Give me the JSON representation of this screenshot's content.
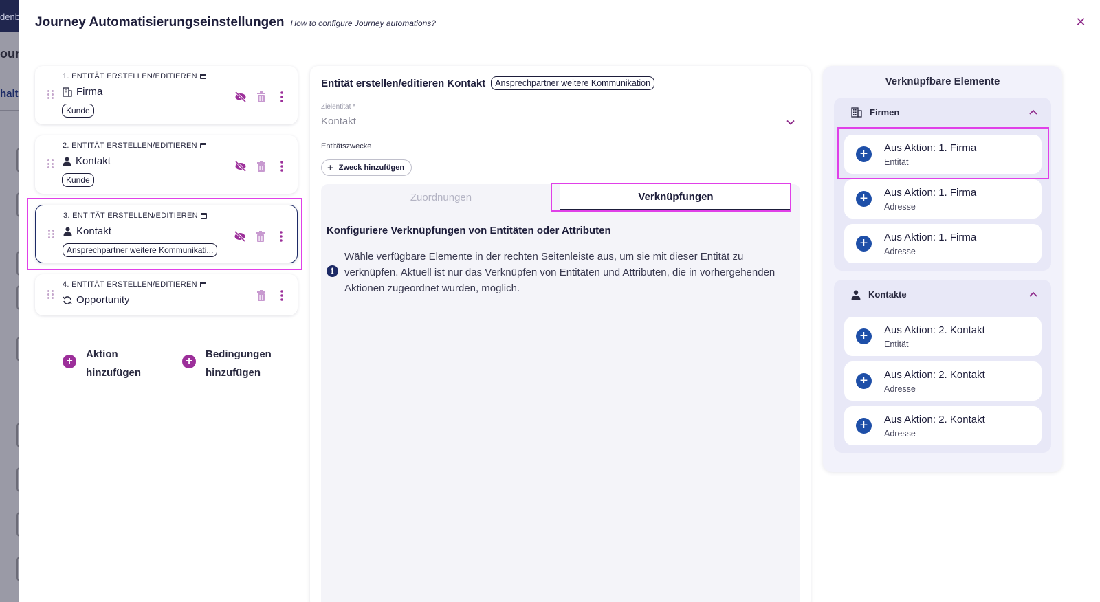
{
  "backdrop": {
    "top_text": "denb",
    "title_text": "our",
    "tab_text": "halt"
  },
  "header": {
    "title": "Journey Automatisierungseinstellungen",
    "help_link": "How to configure Journey automations?"
  },
  "actions": [
    {
      "heading": "1. ENTITÄT ERSTELLEN/EDITIEREN",
      "entity": "Firma",
      "chip": "Kunde",
      "entity_icon": "building-icon"
    },
    {
      "heading": "2. ENTITÄT ERSTELLEN/EDITIEREN",
      "entity": "Kontakt",
      "chip": "Kunde",
      "entity_icon": "person-icon"
    },
    {
      "heading": "3. ENTITÄT ERSTELLEN/EDITIEREN",
      "entity": "Kontakt",
      "chip": "Ansprechpartner weitere Kommunikati...",
      "entity_icon": "person-icon"
    },
    {
      "heading": "4. ENTITÄT ERSTELLEN/EDITIEREN",
      "entity": "Opportunity",
      "entity_icon": "sync-icon"
    }
  ],
  "add_buttons": {
    "action": "Aktion hinzufügen",
    "condition": "Bedingungen hinzufügen"
  },
  "editor": {
    "title": "Entität erstellen/editieren Kontakt",
    "purpose_chip": "Ansprechpartner weitere Kommunikation",
    "target_label": "Zielentität *",
    "target_value": "Kontakt",
    "purposes_label": "Entitätszwecke",
    "add_purpose": "Zweck hinzufügen",
    "tabs": [
      "Zuordnungen",
      "Verknüpfungen"
    ],
    "active_tab": "Verknüpfungen",
    "content_title": "Konfiguriere Verknüpfungen von Entitäten oder Attributen",
    "info_text": "Wähle verfügbare Elemente in der rechten Seitenleiste aus, um sie mit dieser Entität zu verknüpfen. Aktuell ist nur das Verknüpfen von Entitäten und Attributen, die in vorhergehenden Aktionen zugeordnet wurden, möglich."
  },
  "linkable": {
    "title": "Verknüpfbare Elemente",
    "groups": [
      {
        "name": "Firmen",
        "items": [
          {
            "title": "Aus Aktion: 1. Firma",
            "sub": "Entität"
          },
          {
            "title": "Aus Aktion: 1. Firma",
            "sub": "Adresse"
          },
          {
            "title": "Aus Aktion: 1. Firma",
            "sub": "Adresse"
          }
        ]
      },
      {
        "name": "Kontakte",
        "items": [
          {
            "title": "Aus Aktion: 2. Kontakt",
            "sub": "Entität"
          },
          {
            "title": "Aus Aktion: 2. Kontakt",
            "sub": "Adresse"
          },
          {
            "title": "Aus Aktion: 2. Kontakt",
            "sub": "Adresse"
          }
        ]
      }
    ]
  },
  "colors": {
    "accent_purple": "#9c2f9a",
    "navy": "#1d2a66",
    "link_blue": "#1e4fa8",
    "highlight_magenta": "#e040e8"
  }
}
